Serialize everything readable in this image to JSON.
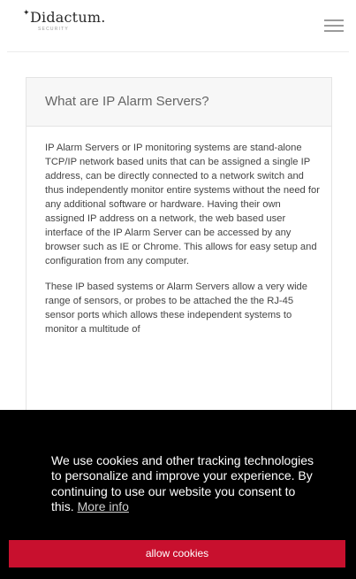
{
  "header": {
    "logo_name": "Didactum.",
    "logo_sub": "SECURITY",
    "logo_star": "✦"
  },
  "card": {
    "title": "What are IP Alarm Servers?",
    "paragraphs": [
      "IP Alarm Servers or IP monitoring systems are stand-alone TCP/IP network based units that can be assigned a single IP address, can be directly connected to a network switch and thus independently monitor entire systems without the need for any additional software or hardware. Having their own assigned IP address on a network, the web based user interface of the IP Alarm Server can be accessed by any browser such as IE or Chrome. This allows for easy setup and configuration from any computer.",
      "These IP based systems or Alarm Servers allow a very wide range of sensors, or probes to be attached the the RJ-45 sensor ports which allows these independent systems to monitor a multitude of"
    ]
  },
  "cookie": {
    "message": "We use cookies and other tracking technologies to personalize and improve your experience. By continuing to use our website you consent to this.",
    "link_label": "More info",
    "button_label": "allow cookies"
  },
  "colors": {
    "accent": "#c8102e",
    "banner_bg": "#000000"
  }
}
